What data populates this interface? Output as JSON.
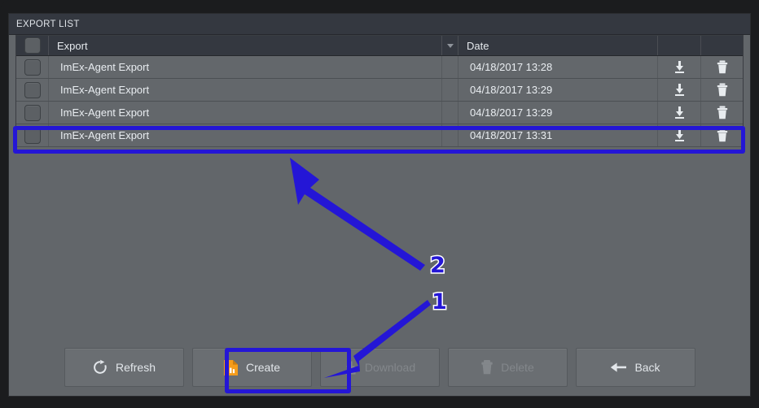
{
  "window": {
    "title": "EXPORT LIST"
  },
  "table": {
    "columns": {
      "select": "",
      "name": "Export",
      "date": "Date",
      "download": "",
      "delete": ""
    },
    "sort_indicator": "chevron-down-icon",
    "rows": [
      {
        "name": "ImEx-Agent Export",
        "date": "04/18/2017 13:28",
        "selected": false,
        "highlighted": false
      },
      {
        "name": "ImEx-Agent Export",
        "date": "04/18/2017 13:29",
        "selected": false,
        "highlighted": false
      },
      {
        "name": "ImEx-Agent Export",
        "date": "04/18/2017 13:29",
        "selected": false,
        "highlighted": false
      },
      {
        "name": "ImEx-Agent Export",
        "date": "04/18/2017 13:31",
        "selected": false,
        "highlighted": true
      }
    ]
  },
  "footer": {
    "buttons": [
      {
        "label": "Refresh",
        "icon": "refresh-icon",
        "disabled": false
      },
      {
        "label": "Create",
        "icon": "new-report-icon",
        "disabled": false
      },
      {
        "label": "Download",
        "icon": "download-icon",
        "disabled": true
      },
      {
        "label": "Delete",
        "icon": "trash-icon",
        "disabled": true
      },
      {
        "label": "Back",
        "icon": "arrow-left-icon",
        "disabled": false
      }
    ]
  },
  "annotations": {
    "step_one": "1",
    "step_two": "2",
    "highlight_color": "#2416d6",
    "outline_color": "#ffffff"
  },
  "colors": {
    "titlebar": "#343840",
    "body": "#62666a",
    "row": "#63676b",
    "accent_orange": "#f59c1a",
    "annotation_blue": "#2416d6"
  }
}
